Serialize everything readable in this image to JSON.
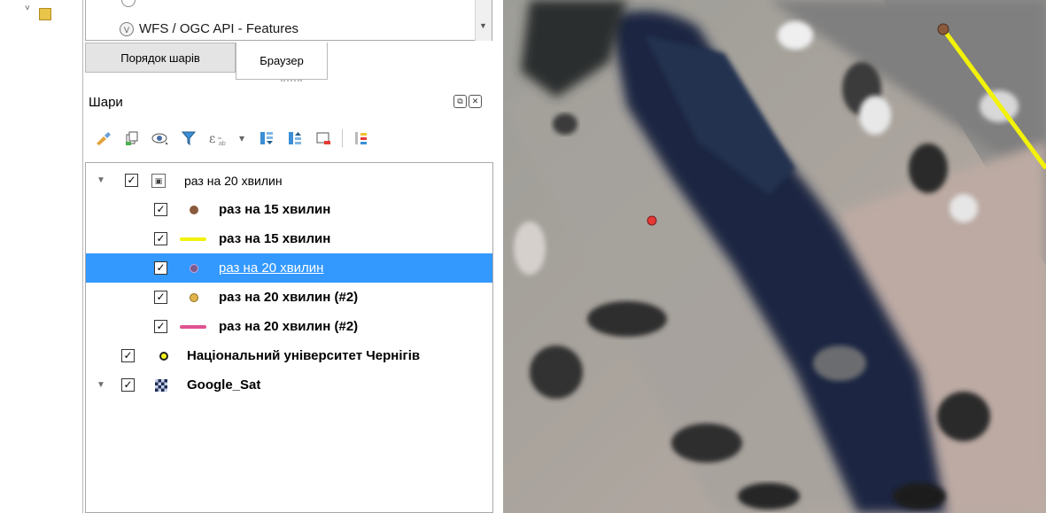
{
  "browser": {
    "items": [
      {
        "label": "WFS / OGC API - Features",
        "icon": "wfs-icon"
      }
    ]
  },
  "tabs": [
    {
      "label": "Порядок шарів",
      "active": false
    },
    {
      "label": "Браузер",
      "active": true
    }
  ],
  "panel": {
    "title": "Шари",
    "toolbar_icons": [
      "open-layer-styling-icon",
      "add-group-icon",
      "manage-visibility-icon",
      "filter-legend-icon",
      "filter-expression-icon",
      "expand-all-icon",
      "collapse-all-icon",
      "remove-layer-icon",
      "map-themes-icon"
    ]
  },
  "layers": [
    {
      "label": "раз на 20 хвилин",
      "type": "group",
      "checked": true,
      "expanded": true,
      "bold": false,
      "selected": false,
      "depth": 0
    },
    {
      "label": "раз на 15 хвилин",
      "type": "point",
      "color": "#8a5a3c",
      "checked": true,
      "bold": true,
      "selected": false,
      "depth": 1
    },
    {
      "label": "раз на 15 хвилин",
      "type": "line",
      "color": "#f2f20a",
      "checked": true,
      "bold": true,
      "selected": false,
      "depth": 1
    },
    {
      "label": "раз на 20 хвилин",
      "type": "point",
      "color": "#7c5b8e",
      "checked": true,
      "bold": false,
      "selected": true,
      "depth": 1
    },
    {
      "label": "раз на 20 хвилин (#2)",
      "type": "point",
      "color": "#e2b54a",
      "checked": true,
      "bold": true,
      "selected": false,
      "depth": 1
    },
    {
      "label": "раз на 20 хвилин (#2)",
      "type": "line",
      "color": "#e0528f",
      "checked": true,
      "bold": true,
      "selected": false,
      "depth": 1
    },
    {
      "label": "Національний університет Чернігів",
      "type": "point-outline",
      "color": "#f5f51a",
      "checked": true,
      "bold": true,
      "selected": false,
      "depth": 0
    },
    {
      "label": "Google_Sat",
      "type": "raster",
      "checked": true,
      "expanded": true,
      "bold": true,
      "selected": false,
      "depth": 0
    }
  ],
  "colors": {
    "selection": "#3399ff",
    "line_feature": "#f2f20a",
    "point_brown": "#8a5a3c",
    "point_red": "#e53935"
  }
}
